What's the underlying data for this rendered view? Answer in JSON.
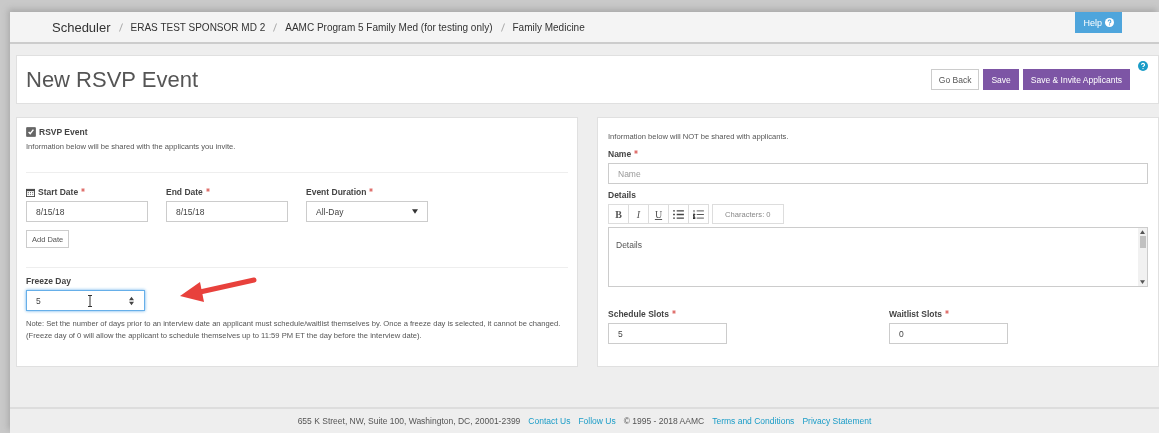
{
  "breadcrumbs": [
    {
      "label": "Scheduler",
      "kind": "home"
    },
    {
      "label": "ERAS TEST SPONSOR MD 2",
      "kind": "crumb"
    },
    {
      "label": "AAMC Program 5 Family Med (for testing only)",
      "kind": "crumb"
    },
    {
      "label": "Family Medicine",
      "kind": "crumb"
    }
  ],
  "help_button": {
    "label": "Help"
  },
  "page_title": "New RSVP Event",
  "actions": [
    {
      "label": "Go Back",
      "kind": "default"
    },
    {
      "label": "Save",
      "kind": "primary"
    },
    {
      "label": "Save & Invite Applicants",
      "kind": "primary"
    }
  ],
  "left_panel": {
    "rsvp": {
      "label": "RSVP Event",
      "checked": true
    },
    "shared_note": "Information below will be shared with the applicants you invite.",
    "fields": [
      {
        "label": "Start Date",
        "required": true,
        "value": "8/15/18",
        "kind": "date"
      },
      {
        "label": "End Date",
        "required": true,
        "value": "8/15/18",
        "kind": "text"
      },
      {
        "label": "Event Duration",
        "required": true,
        "value": "All-Day",
        "kind": "select"
      }
    ],
    "add_date_button": "Add Date",
    "freeze_day": {
      "label": "Freeze Day",
      "value": "5"
    },
    "note": "Note: Set the number of days prior to an interview date an applicant must schedule/waitlist themselves by. Once a freeze day is selected, it cannot be changed. (Freeze day of 0 will allow the applicant to schedule themselves up to 11:59 PM ET the day before the interview date)."
  },
  "right_panel": {
    "private_note": "Information below will NOT be shared with applicants.",
    "name": {
      "label": "Name",
      "required": true,
      "placeholder": "Name"
    },
    "details": {
      "label": "Details",
      "toolbar": [
        {
          "label": "B",
          "kind": "bold"
        },
        {
          "label": "I",
          "kind": "italic"
        },
        {
          "label": "U",
          "kind": "underline"
        },
        {
          "kind": "bullets"
        },
        {
          "kind": "numbers"
        }
      ],
      "counter": "Characters: 0",
      "placeholder": "Details"
    },
    "slots": [
      {
        "label": "Schedule Slots",
        "required": true,
        "value": "5"
      },
      {
        "label": "Waitlist Slots",
        "required": true,
        "value": "0"
      }
    ]
  },
  "footer": [
    {
      "text": "655 K Street, NW, Suite 100, Washington, DC, 20001-2399",
      "kind": "text"
    },
    {
      "text": "Contact Us",
      "kind": "link"
    },
    {
      "text": "Follow Us",
      "kind": "link"
    },
    {
      "text": "© 1995 - 2018 AAMC",
      "kind": "text"
    },
    {
      "text": "Terms and Conditions",
      "kind": "link"
    },
    {
      "text": "Privacy Statement",
      "kind": "link"
    }
  ]
}
